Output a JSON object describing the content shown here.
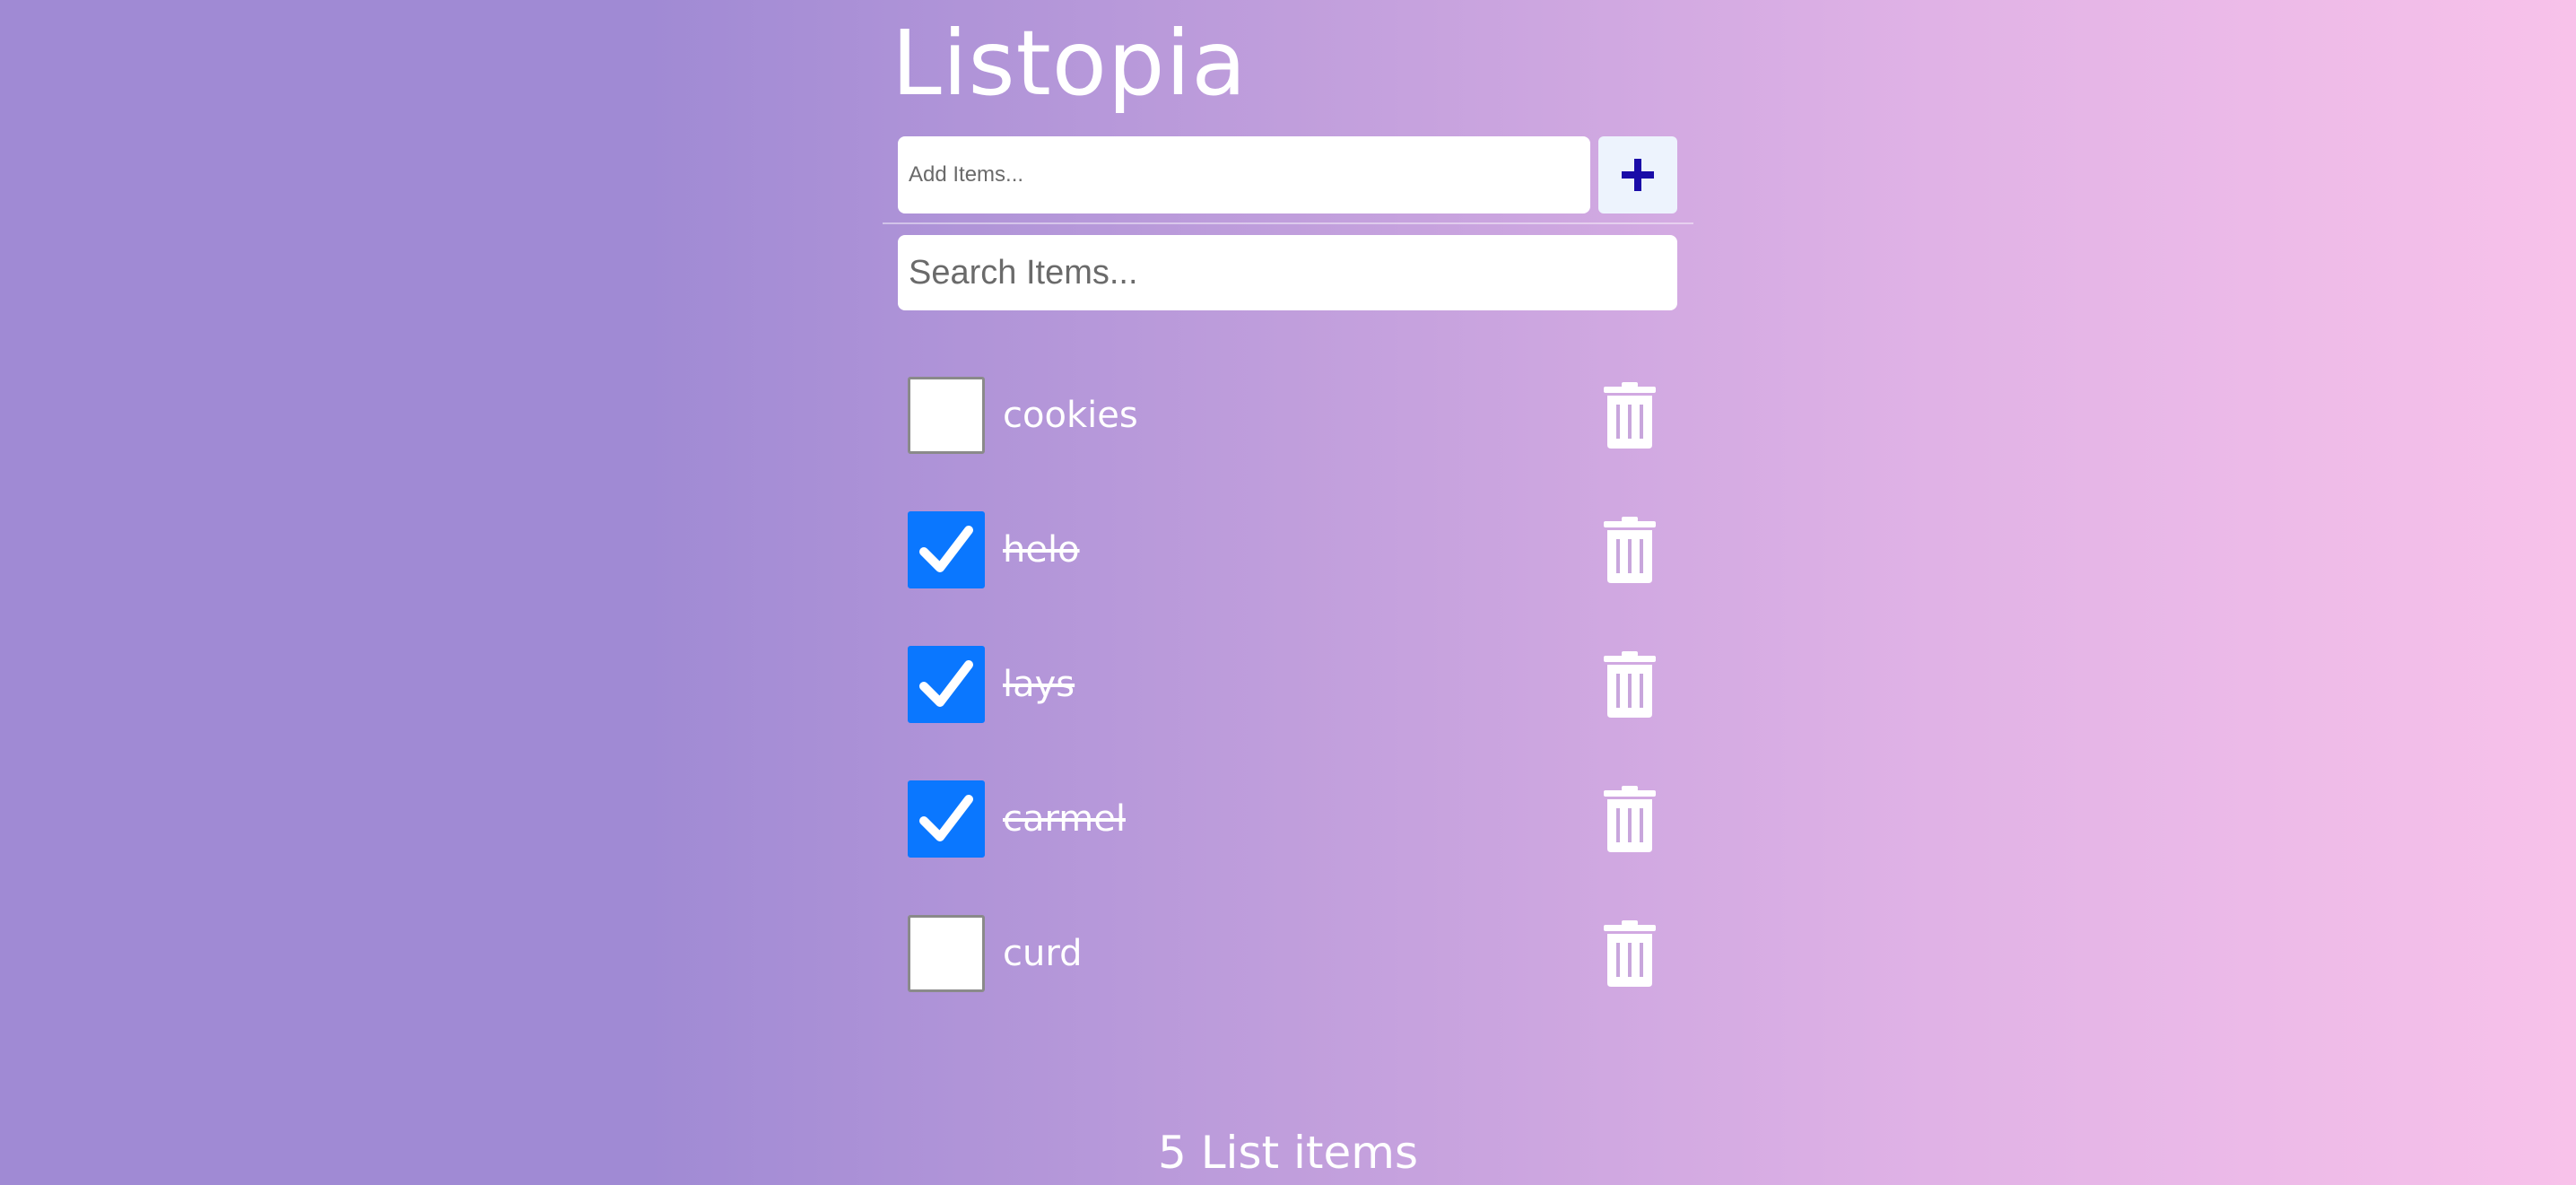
{
  "app": {
    "title": "Listopia"
  },
  "add": {
    "placeholder": "Add Items...",
    "button_icon": "plus-icon"
  },
  "search": {
    "placeholder": "Search Items..."
  },
  "colors": {
    "checkbox_checked": "#0a77ff",
    "add_button_bg": "#edf3fd",
    "plus": "#1a0ca8"
  },
  "items": [
    {
      "label": "cookies",
      "checked": false
    },
    {
      "label": "helo",
      "checked": true
    },
    {
      "label": "lays",
      "checked": true
    },
    {
      "label": "carmel",
      "checked": true
    },
    {
      "label": "curd",
      "checked": false
    }
  ],
  "footer": {
    "count_text": "5 List items"
  }
}
